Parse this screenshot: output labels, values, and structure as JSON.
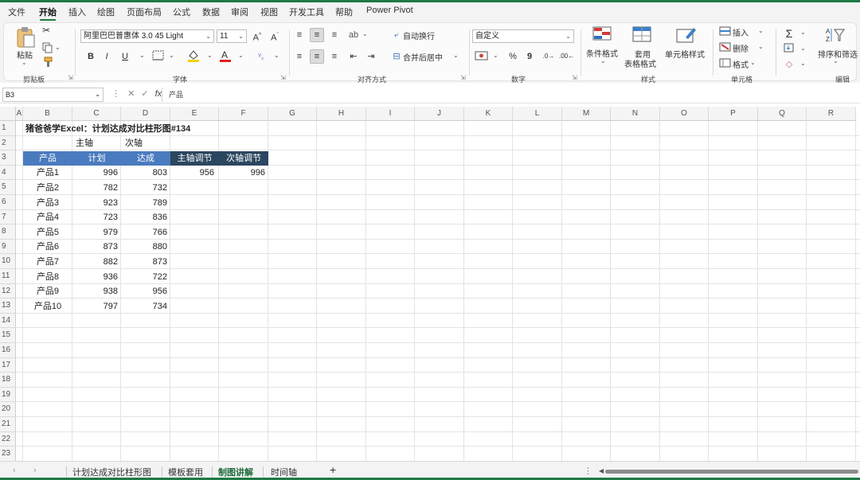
{
  "menu": {
    "tabs": [
      {
        "label": "文件",
        "active": false
      },
      {
        "label": "开始",
        "active": true
      },
      {
        "label": "插入",
        "active": false
      },
      {
        "label": "绘图",
        "active": false
      },
      {
        "label": "页面布局",
        "active": false
      },
      {
        "label": "公式",
        "active": false
      },
      {
        "label": "数据",
        "active": false
      },
      {
        "label": "审阅",
        "active": false
      },
      {
        "label": "视图",
        "active": false
      },
      {
        "label": "开发工具",
        "active": false
      },
      {
        "label": "帮助",
        "active": false
      },
      {
        "label": "Power Pivot",
        "active": false
      }
    ]
  },
  "ribbon": {
    "clipboard": {
      "paste_label": "粘贴",
      "group_label": "剪贴板"
    },
    "font": {
      "font_name": "阿里巴巴普惠体 3.0 45 Light",
      "font_size": "11",
      "bold": "B",
      "italic": "I",
      "underline": "U",
      "group_label": "字体"
    },
    "alignment": {
      "wrap_label": "自动换行",
      "merge_label": "合并后居中",
      "group_label": "对齐方式"
    },
    "number": {
      "format_value": "自定义",
      "percent": "%",
      "comma": "9",
      "group_label": "数字"
    },
    "styles": {
      "conditional_label": "条件格式",
      "table_label_line1": "套用",
      "table_label_line2": "表格格式",
      "cell_styles_label": "单元格样式",
      "group_label": "样式"
    },
    "cells": {
      "insert_label": "插入",
      "delete_label": "删除",
      "format_label": "格式",
      "group_label": "单元格"
    },
    "editing": {
      "sort_filter_label": "排序和筛选",
      "group_label": "编辑"
    }
  },
  "formula_bar": {
    "name_box": "B3",
    "formula": "产品"
  },
  "columns": [
    "A",
    "B",
    "C",
    "D",
    "E",
    "F",
    "G",
    "H",
    "I",
    "J",
    "K",
    "L",
    "M",
    "N",
    "O",
    "P",
    "Q",
    "R"
  ],
  "rows": [
    "1",
    "2",
    "3",
    "4",
    "5",
    "6",
    "7",
    "8",
    "9",
    "10",
    "11",
    "12",
    "13",
    "14",
    "15",
    "16",
    "17",
    "18",
    "19",
    "20",
    "21",
    "22",
    "23"
  ],
  "sheet": {
    "title": "猪爸爸学Excel：计划达成对比柱形图#134",
    "axis_primary": "主轴",
    "axis_secondary": "次轴",
    "headers": [
      "产品",
      "计划",
      "达成"
    ],
    "adjust_headers": [
      "主轴调节",
      "次轴调节"
    ],
    "adjust_values": [
      "956",
      "996"
    ],
    "table": [
      {
        "product": "产品1",
        "plan": "996",
        "actual": "803"
      },
      {
        "product": "产品2",
        "plan": "782",
        "actual": "732"
      },
      {
        "product": "产品3",
        "plan": "923",
        "actual": "789"
      },
      {
        "product": "产品4",
        "plan": "723",
        "actual": "836"
      },
      {
        "product": "产品5",
        "plan": "979",
        "actual": "766"
      },
      {
        "product": "产品6",
        "plan": "873",
        "actual": "880"
      },
      {
        "product": "产品7",
        "plan": "882",
        "actual": "873"
      },
      {
        "product": "产品8",
        "plan": "936",
        "actual": "722"
      },
      {
        "product": "产品9",
        "plan": "938",
        "actual": "956"
      },
      {
        "product": "产品10",
        "plan": "797",
        "actual": "734"
      }
    ],
    "colors": {
      "header_blue": "#4a7bbe",
      "header_dark": "#2b4660",
      "accent_green": "#1f7a45"
    }
  },
  "sheet_tabs": [
    {
      "label": "计划达成对比柱形图",
      "active": false
    },
    {
      "label": "模板套用",
      "active": false
    },
    {
      "label": "制图讲解",
      "active": true
    },
    {
      "label": "时间轴",
      "active": false
    }
  ],
  "add_sheet": "+"
}
